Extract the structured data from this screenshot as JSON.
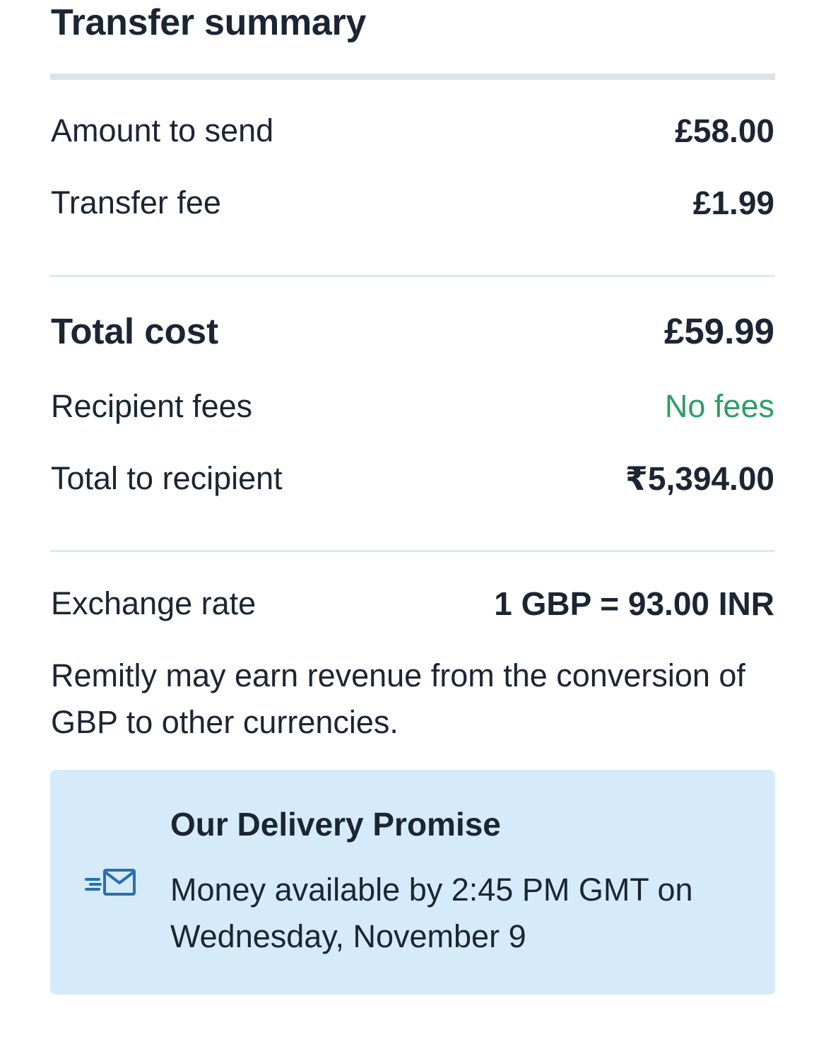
{
  "header": {
    "title": "Transfer summary"
  },
  "summary": {
    "amount_to_send": {
      "label": "Amount to send",
      "value": "£58.00"
    },
    "transfer_fee": {
      "label": "Transfer fee",
      "value": "£1.99"
    },
    "total_cost": {
      "label": "Total cost",
      "value": "£59.99"
    },
    "recipient_fees": {
      "label": "Recipient fees",
      "value": "No fees"
    },
    "total_to_recipient": {
      "label": "Total to recipient",
      "value": "₹5,394.00"
    },
    "exchange_rate": {
      "label": "Exchange rate",
      "value": "1 GBP = 93.00 INR"
    }
  },
  "disclaimer": "Remitly may earn revenue from the conversion of GBP to other currencies.",
  "delivery_promise": {
    "title": "Our Delivery Promise",
    "body": "Money available by 2:45 PM GMT on Wednesday, November 9",
    "icon": "fast-envelope-icon"
  },
  "colors": {
    "text": "#1c2533",
    "positive": "#2e9d67",
    "promise_background": "#d5ebf9",
    "icon": "#2a6fb0",
    "divider": "#dde3ec"
  }
}
